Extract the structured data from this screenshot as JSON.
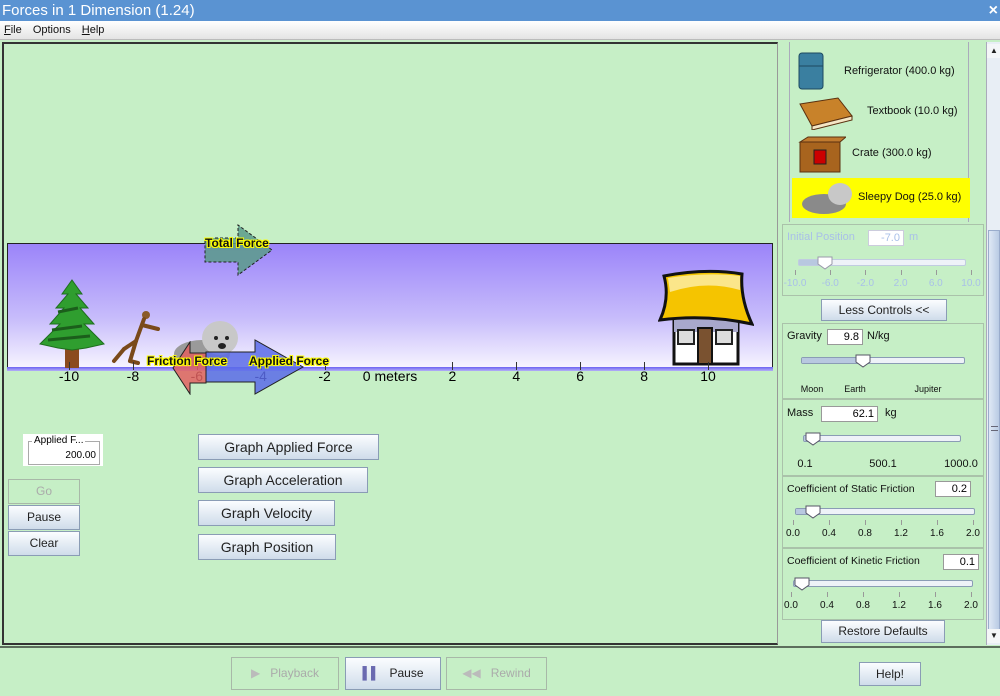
{
  "window": {
    "title": "Forces in 1 Dimension (1.24)",
    "close_icon": "×"
  },
  "menu": [
    {
      "mnemonic": "F",
      "rest": "ile"
    },
    {
      "mnemonic": "",
      "rest": "Options"
    },
    {
      "mnemonic": "H",
      "rest": "elp"
    }
  ],
  "scene": {
    "axis_unit": "0 meters",
    "ticks": [
      "-10",
      "-8",
      "-6",
      "-4",
      "-2",
      "2",
      "4",
      "6",
      "8",
      "10"
    ],
    "forces": {
      "total": "Total Force",
      "friction": "Friction Force",
      "applied": "Applied Force"
    },
    "colors": {
      "total": "#5a9b8a",
      "friction": "#e06060",
      "applied": "#5b6be8",
      "sky_top": "#9b84f9",
      "ground": "#6c62f2"
    }
  },
  "applied_force": {
    "label": "Applied F...",
    "value": "200.00"
  },
  "controls": {
    "go": "Go",
    "pause": "Pause",
    "clear": "Clear"
  },
  "graphs": {
    "applied_force": "Graph Applied Force",
    "acceleration": "Graph Acceleration",
    "velocity": "Graph Velocity",
    "position": "Graph Position"
  },
  "objects": [
    {
      "name": "Refrigerator (400.0 kg)",
      "selected": false
    },
    {
      "name": "Textbook (10.0 kg)",
      "selected": false
    },
    {
      "name": "Crate (300.0 kg)",
      "selected": false
    },
    {
      "name": "Sleepy Dog (25.0 kg)",
      "selected": true
    }
  ],
  "initial_position": {
    "label": "Initial Position",
    "value": "-7.0",
    "unit": "m",
    "min": -10,
    "max": 10,
    "current": -7.0,
    "ticks": [
      "-10.0",
      "-6.0",
      "-2.0",
      "2.0",
      "6.0",
      "10.0"
    ]
  },
  "less_controls": "Less Controls <<",
  "gravity": {
    "label": "Gravity",
    "value": "9.8",
    "unit": "N/kg",
    "fraction": 0.38,
    "ticks": [
      "Moon",
      "Earth",
      "Jupiter"
    ]
  },
  "mass": {
    "label": "Mass",
    "value": "62.1",
    "unit": "kg",
    "fraction": 0.062,
    "ticks": [
      "0.1",
      "500.1",
      "1000.0"
    ]
  },
  "static_friction": {
    "label": "Coefficient of Static Friction",
    "value": "0.2",
    "fraction": 0.1,
    "ticks": [
      "0.0",
      "0.4",
      "0.8",
      "1.2",
      "1.6",
      "2.0"
    ]
  },
  "kinetic_friction": {
    "label": "Coefficient of Kinetic Friction",
    "value": "0.1",
    "fraction": 0.05,
    "ticks": [
      "0.0",
      "0.4",
      "0.8",
      "1.2",
      "1.6",
      "2.0"
    ]
  },
  "restore_defaults": "Restore Defaults",
  "playback": {
    "playback": "Playback",
    "pause": "Pause",
    "rewind": "Rewind"
  },
  "help": "Help!"
}
